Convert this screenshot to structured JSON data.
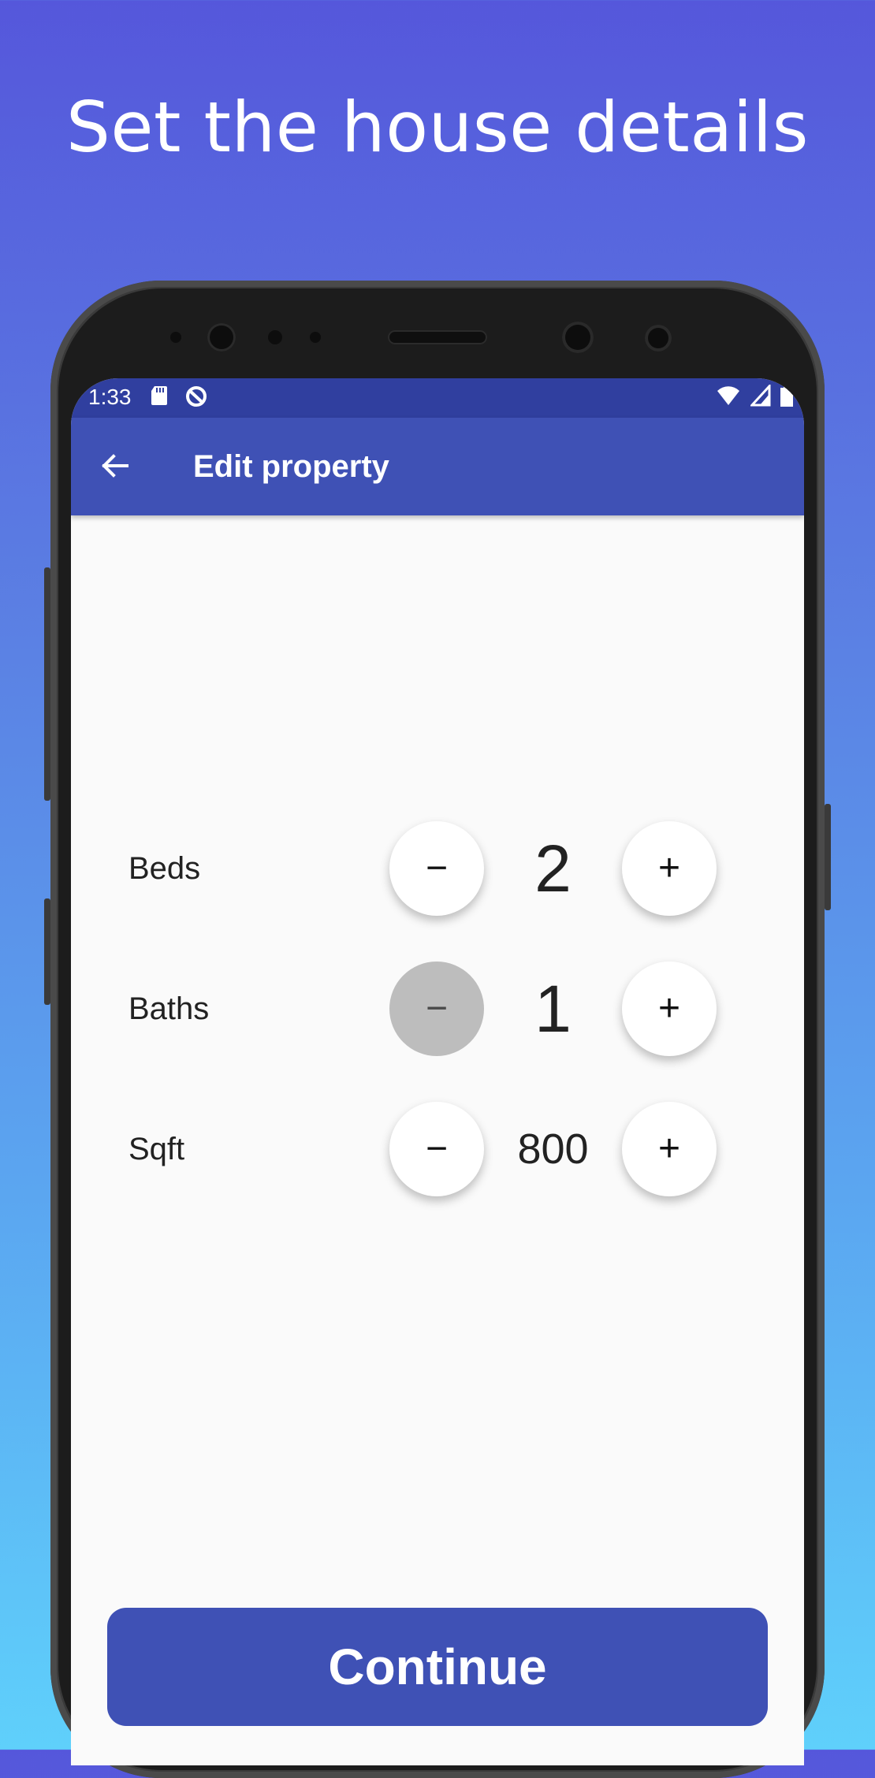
{
  "headline": "Set the house details",
  "status_bar": {
    "time": "1:33",
    "icons_left": [
      "sd-card-icon",
      "data-saver-icon"
    ],
    "icons_right": [
      "wifi-icon",
      "signal-icon",
      "battery-icon"
    ]
  },
  "app_bar": {
    "back_icon": "arrow-left-icon",
    "title": "Edit property"
  },
  "stepper_rows": [
    {
      "label": "Beds",
      "value": "2",
      "decrement": "−",
      "increment": "+",
      "decrement_enabled": true
    },
    {
      "label": "Baths",
      "value": "1",
      "decrement": "−",
      "increment": "+",
      "decrement_enabled": false
    },
    {
      "label": "Sqft",
      "value": "800",
      "decrement": "−",
      "increment": "+",
      "decrement_enabled": true
    }
  ],
  "continue_label": "Continue",
  "colors": {
    "primary": "#3F51B5",
    "primary_dark": "#303F9F",
    "background": "#FAFAFA",
    "disabled": "#BDBDBD"
  }
}
